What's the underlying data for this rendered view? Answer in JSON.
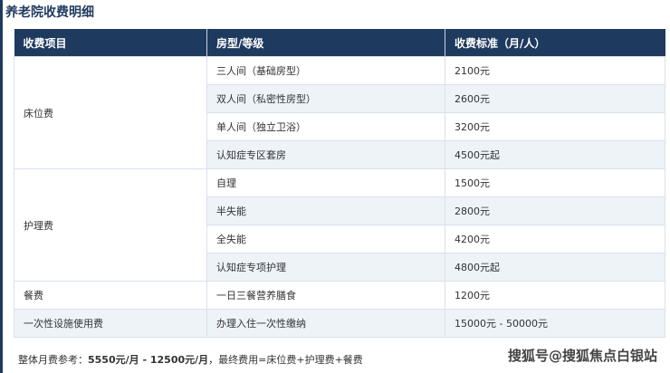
{
  "title": "养老院收费明细",
  "headers": [
    "收费项目",
    "房型/等级",
    "收费标准（月/人）"
  ],
  "groups": [
    {
      "name": "床位费",
      "rows": [
        {
          "type": "三人间（基础房型）",
          "price": "2100元"
        },
        {
          "type": "双人间（私密性房型）",
          "price": "2600元"
        },
        {
          "type": "单人间（独立卫浴）",
          "price": "3200元"
        },
        {
          "type": "认知症专区套房",
          "price": "4500元起"
        }
      ]
    },
    {
      "name": "护理费",
      "rows": [
        {
          "type": "自理",
          "price": "1500元"
        },
        {
          "type": "半失能",
          "price": "2800元"
        },
        {
          "type": "全失能",
          "price": "4200元"
        },
        {
          "type": "认知症专项护理",
          "price": "4800元起"
        }
      ]
    },
    {
      "name": "餐费",
      "rows": [
        {
          "type": "一日三餐营养膳食",
          "price": "1200元"
        }
      ]
    },
    {
      "name": "一次性设施使用费",
      "rows": [
        {
          "type": "办理入住一次性缴纳",
          "price": "15000元 - 50000元"
        }
      ]
    }
  ],
  "note": {
    "prefix": "整体月费参考：",
    "range": "5550元/月 - 12500元/月",
    "suffix": "，最终费用=床位费+护理费+餐费"
  },
  "watermark": "搜狐号@搜狐焦点白银站"
}
